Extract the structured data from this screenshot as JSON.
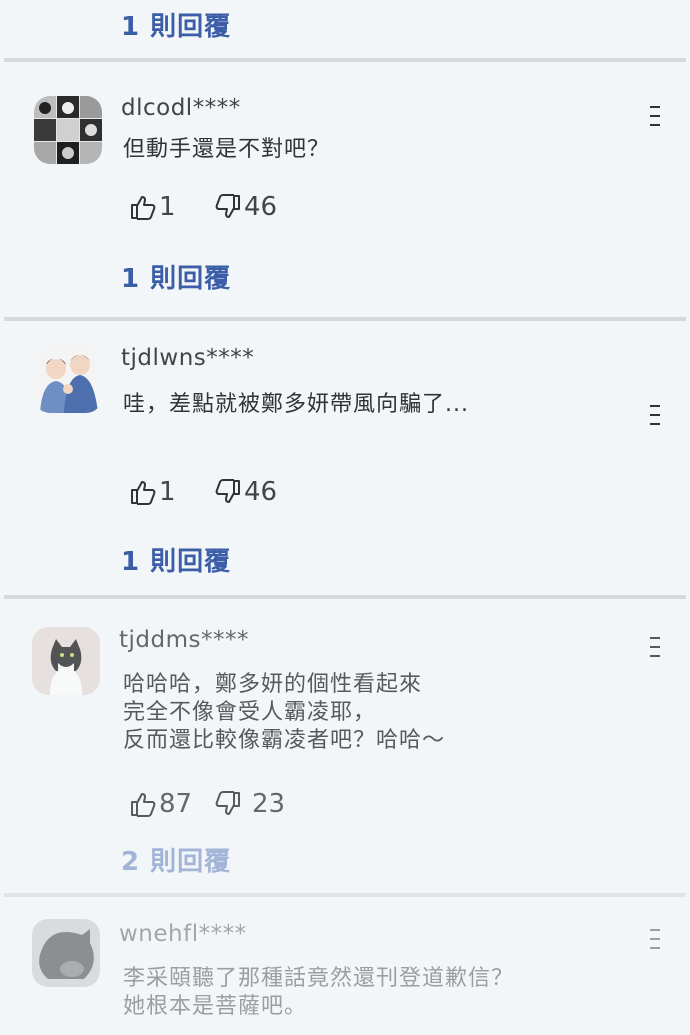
{
  "top_reply": {
    "label": "1 則回覆"
  },
  "comments": [
    {
      "username": "dlcodl****",
      "text": "但動手還是不對吧？",
      "likes": "1",
      "dislikes": "46",
      "reply_label": "1 則回覆",
      "avatar": "cat-grid-avatar"
    },
    {
      "username": "tjdlwns****",
      "text": "哇，差點就被鄭多妍帶風向騙了...",
      "likes": "1",
      "dislikes": "46",
      "reply_label": "1 則回覆",
      "avatar": "couple-illustration-avatar"
    },
    {
      "username": "tjddms****",
      "text": "哈哈哈，鄭多妍的個性看起來\n完全不像會受人霸凌耶，\n反而還比較像霸凌者吧？哈哈～",
      "likes": "87",
      "dislikes": "23",
      "reply_label": "2 則回覆",
      "avatar": "cat-photo-avatar"
    },
    {
      "username": "wnehfl****",
      "text": "李采頤聽了那種話竟然還刊登道歉信？\n她根本是菩薩吧。",
      "avatar": "black-cat-avatar"
    }
  ],
  "icons": {
    "like": "thumbs-up-icon",
    "dislike": "thumbs-down-icon",
    "menu": "more-menu-icon"
  },
  "colors": {
    "background": "#f2f6f9",
    "reply_link": "#3c5ea8",
    "divider": "#d4d9dd"
  }
}
